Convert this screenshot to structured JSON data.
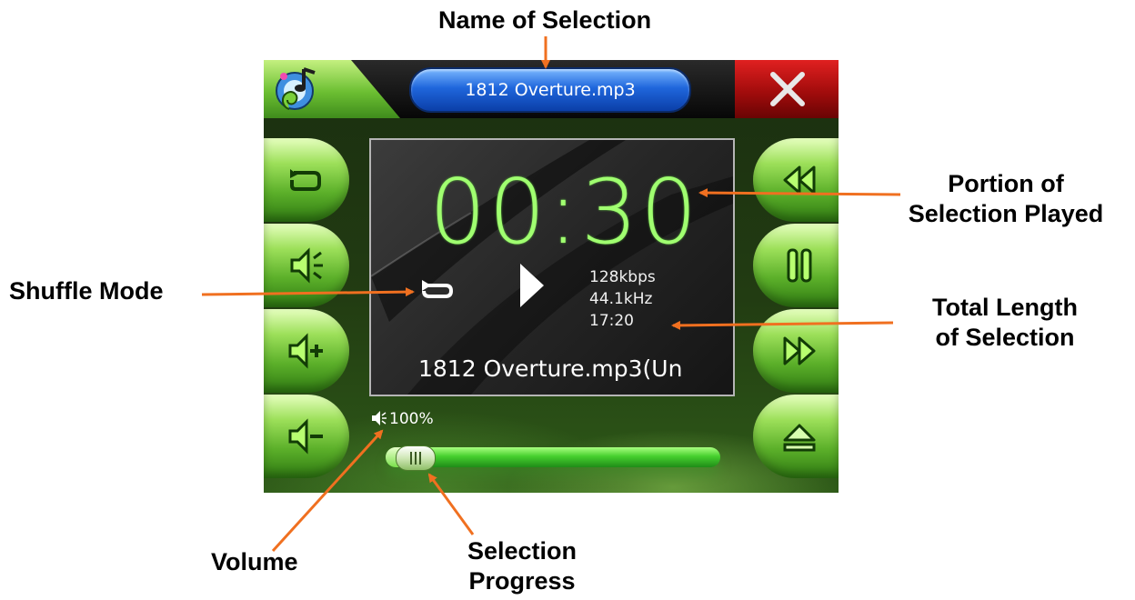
{
  "callouts": {
    "name_of_selection": "Name of Selection",
    "portion_played_line1": "Portion of",
    "portion_played_line2": "Selection Played",
    "shuffle_mode": "Shuffle Mode",
    "total_length_line1": "Total Length",
    "total_length_line2": "of Selection",
    "volume": "Volume",
    "selection_progress_line1": "Selection",
    "selection_progress_line2": "Progress"
  },
  "colors": {
    "arrow": "#f07020",
    "time_digits": "#a0ff70",
    "title_pill": "#1f66dc",
    "close_button": "#c01010",
    "button_green": "#6cbf32"
  },
  "player": {
    "title": "1812 Overture.mp3",
    "app_icon": "music-note-icon",
    "close_icon": "close-icon",
    "left_buttons": [
      {
        "icon": "repeat-icon"
      },
      {
        "icon": "mute-speaker-icon"
      },
      {
        "icon": "volume-up-icon"
      },
      {
        "icon": "volume-down-icon"
      }
    ],
    "right_buttons": [
      {
        "icon": "rewind-icon"
      },
      {
        "icon": "pause-icon"
      },
      {
        "icon": "fast-forward-icon"
      },
      {
        "icon": "eject-icon"
      }
    ],
    "screen": {
      "elapsed_time": "00:30",
      "bitrate": "128kbps",
      "sample_rate": "44.1kHz",
      "total_length": "17:20",
      "song_marquee": "1812 Overture.mp3(Un",
      "mode_icon": "repeat-icon",
      "status_icon": "play-icon"
    },
    "volume_text": "100%",
    "progress_fraction": 0.029
  }
}
